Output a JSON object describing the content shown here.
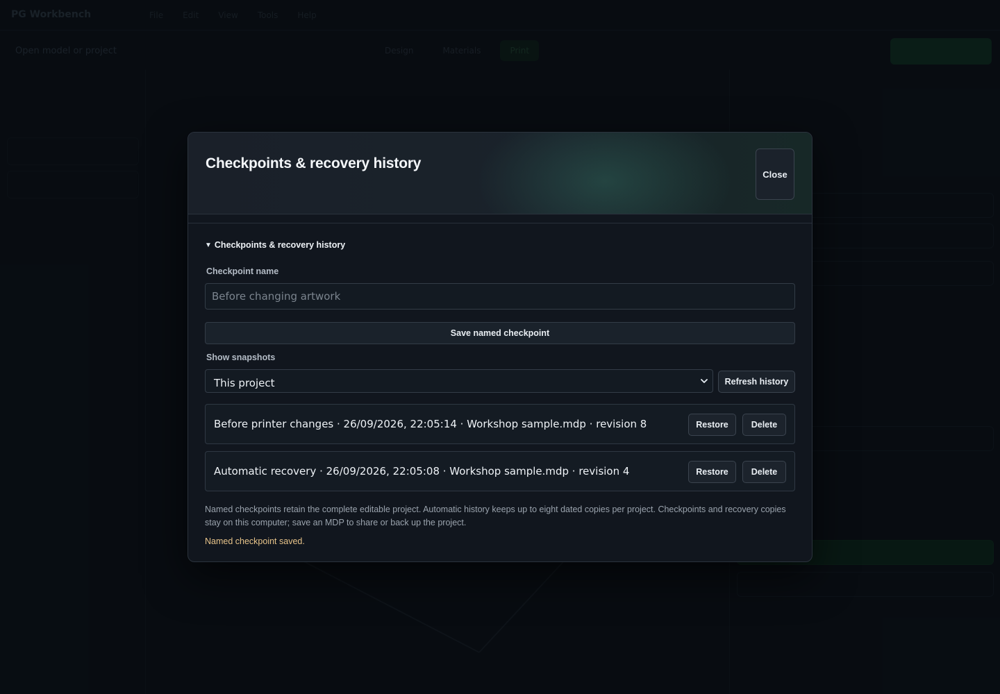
{
  "background": {
    "brand": "PG Workbench",
    "menu": [
      "File",
      "Edit",
      "View",
      "Tools",
      "Help"
    ],
    "open_label": "Open model or project",
    "segments": [
      "Design",
      "Materials",
      "Print"
    ]
  },
  "modal": {
    "title": "Checkpoints & recovery history",
    "close_label": "Close",
    "section_title": "Checkpoints & recovery history",
    "checkpoint_name_label": "Checkpoint name",
    "checkpoint_name_placeholder": "Before changing artwork",
    "checkpoint_name_value": "",
    "save_button_label": "Save named checkpoint",
    "show_snapshots_label": "Show snapshots",
    "snapshot_filter_selected": "This project",
    "refresh_button_label": "Refresh history",
    "snapshots": [
      {
        "text": "Before printer changes · 26/09/2026, 22:05:14 · Workshop sample.mdp · revision 8",
        "restore_label": "Restore",
        "delete_label": "Delete"
      },
      {
        "text": "Automatic recovery · 26/09/2026, 22:05:08 · Workshop sample.mdp · revision 4",
        "restore_label": "Restore",
        "delete_label": "Delete"
      }
    ],
    "note": "Named checkpoints retain the complete editable project. Automatic history keeps up to eight dated copies per project. Checkpoints and recovery copies stay on this computer; save an MDP to share or back up the project.",
    "status": "Named checkpoint saved."
  },
  "colors": {
    "accent_green": "#3e967c",
    "status_text": "#e8c48a",
    "modal_bg": "#11161e"
  }
}
